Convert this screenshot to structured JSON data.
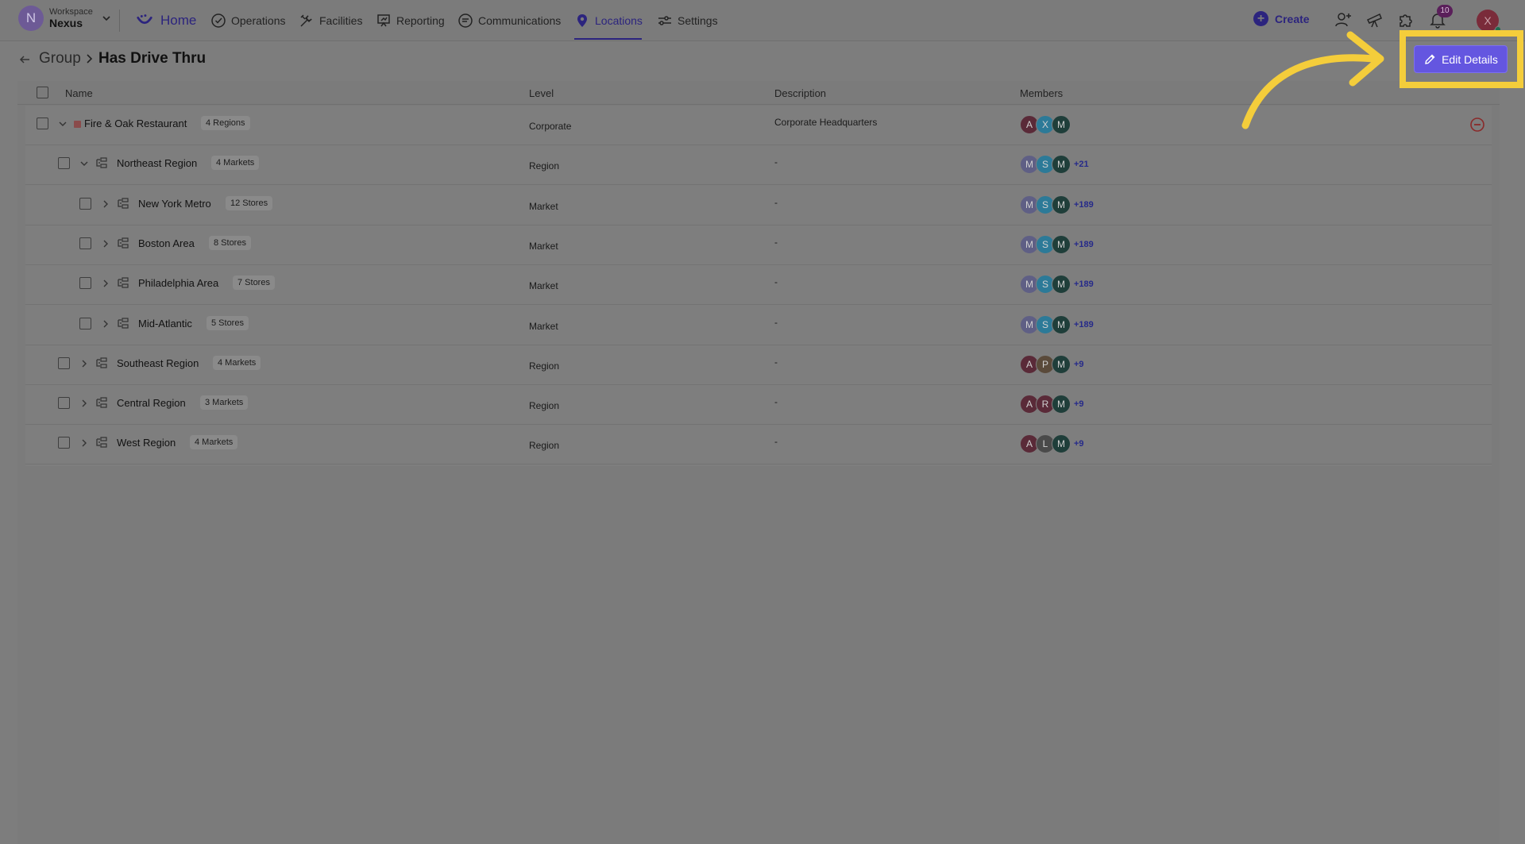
{
  "workspace": {
    "label": "Workspace",
    "name": "Nexus",
    "initial": "N"
  },
  "nav": {
    "home": "Home",
    "items": [
      "Operations",
      "Facilities",
      "Reporting",
      "Communications",
      "Locations",
      "Settings"
    ],
    "create": "Create",
    "notifications": "10",
    "user_initial": "X"
  },
  "breadcrumb": {
    "parent": "Group",
    "current": "Has Drive Thru"
  },
  "edit_button": "Edit Details",
  "table": {
    "headers": {
      "name": "Name",
      "level": "Level",
      "description": "Description",
      "members": "Members"
    },
    "rows": [
      {
        "name": "Fire & Oak Restaurant",
        "chip": "4 Regions",
        "level": "Corporate",
        "description": "Corporate Headquarters",
        "avatars": [
          "A",
          "X",
          "M"
        ],
        "more": ""
      },
      {
        "name": "Northeast Region",
        "chip": "4 Markets",
        "level": "Region",
        "description": "-",
        "avatars": [
          "M",
          "S",
          "M"
        ],
        "more": "+21"
      },
      {
        "name": "New York Metro",
        "chip": "12 Stores",
        "level": "Market",
        "description": "-",
        "avatars": [
          "M",
          "S",
          "M"
        ],
        "more": "+189"
      },
      {
        "name": "Boston Area",
        "chip": "8 Stores",
        "level": "Market",
        "description": "-",
        "avatars": [
          "M",
          "S",
          "M"
        ],
        "more": "+189"
      },
      {
        "name": "Philadelphia Area",
        "chip": "7 Stores",
        "level": "Market",
        "description": "-",
        "avatars": [
          "M",
          "S",
          "M"
        ],
        "more": "+189"
      },
      {
        "name": "Mid-Atlantic",
        "chip": "5 Stores",
        "level": "Market",
        "description": "-",
        "avatars": [
          "M",
          "S",
          "M"
        ],
        "more": "+189"
      },
      {
        "name": "Southeast Region",
        "chip": "4 Markets",
        "level": "Region",
        "description": "-",
        "avatars": [
          "A",
          "P",
          "M"
        ],
        "more": "+9"
      },
      {
        "name": "Central Region",
        "chip": "3 Markets",
        "level": "Region",
        "description": "-",
        "avatars": [
          "A",
          "R",
          "M"
        ],
        "more": "+9"
      },
      {
        "name": "West Region",
        "chip": "4 Markets",
        "level": "Region",
        "description": "-",
        "avatars": [
          "A",
          "L",
          "M"
        ],
        "more": "+9"
      }
    ]
  },
  "colors": {
    "accent": "#6456e0",
    "highlight": "#f4cd3b",
    "nav_active": "#2c247e"
  }
}
